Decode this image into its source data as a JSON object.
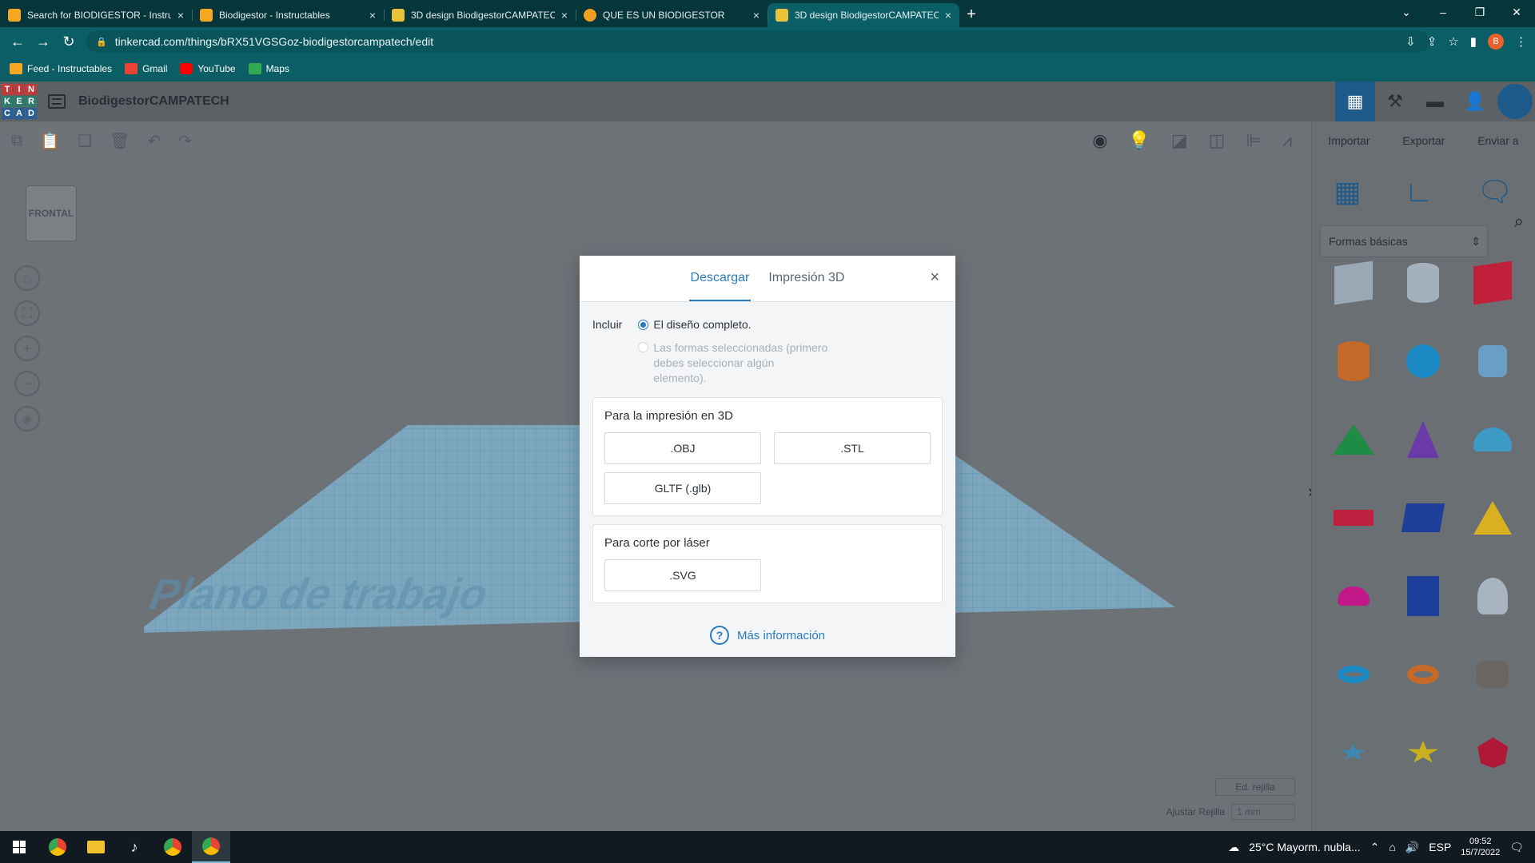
{
  "browser": {
    "tabs": [
      {
        "title": "Search for BIODIGESTOR - Instruc",
        "active": false,
        "favicon_color": "#f5a623"
      },
      {
        "title": "Biodigestor - Instructables",
        "active": false,
        "favicon_color": "#f5a623"
      },
      {
        "title": "3D design BiodigestorCAMPATEC",
        "active": false,
        "favicon_color": "#e8c23a"
      },
      {
        "title": "QUE ES UN BIODIGESTOR",
        "active": false,
        "favicon_color": "#f0a020"
      },
      {
        "title": "3D design BiodigestorCAMPATEC",
        "active": true,
        "favicon_color": "#e8c23a"
      }
    ],
    "tab_close": "×",
    "new_tab": "+",
    "window_controls": {
      "tab_search": "⌄",
      "minimize": "–",
      "restore": "❐",
      "close": "✕"
    },
    "url": "tinkercad.com/things/bRX51VGSGoz-biodigestorcampatech/edit",
    "profile_initial": "B",
    "bookmarks": [
      {
        "label": "Feed - Instructables",
        "icon_color": "#f5a623"
      },
      {
        "label": "Gmail",
        "icon_color": "#ea4335"
      },
      {
        "label": "YouTube",
        "icon_color": "#ff0000"
      },
      {
        "label": "Maps",
        "icon_color": "#34a853"
      }
    ]
  },
  "app": {
    "logo_letters": [
      "T",
      "I",
      "N",
      "K",
      "E",
      "R",
      "C",
      "A",
      "D"
    ],
    "design_title": "BiodigestorCAMPATECH",
    "panel_buttons": {
      "import": "Importar",
      "export": "Exportar",
      "send": "Enviar a"
    },
    "shapes_category": "Formas básicas",
    "viewcube_label": "FRONTAL",
    "workplane_text": "Plano de trabajo",
    "edit_grid": "Ed. rejilla",
    "snap_grid_label": "Ajustar Rejilla",
    "snap_grid_value": "1 mm"
  },
  "modal": {
    "tabs": {
      "download": "Descargar",
      "print": "Impresión 3D"
    },
    "close": "×",
    "include_label": "Incluir",
    "option_full": "El diseño completo.",
    "option_selected": "Las formas seleccionadas (primero debes seleccionar algún elemento).",
    "section_3d": "Para la impresión en 3D",
    "btn_obj": ".OBJ",
    "btn_stl": ".STL",
    "btn_gltf": "GLTF (.glb)",
    "section_laser": "Para corte por láser",
    "btn_svg": ".SVG",
    "more_info": "Más información"
  },
  "taskbar": {
    "weather": "25°C  Mayorm. nubla...",
    "language": "ESP",
    "time": "09:52",
    "date": "15/7/2022"
  }
}
